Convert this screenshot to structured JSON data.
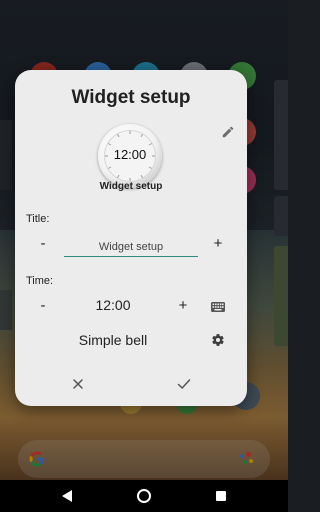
{
  "dialog": {
    "title": "Widget setup",
    "preview": {
      "clock_time": "12:00",
      "label": "Widget setup"
    },
    "title_section": {
      "label": "Title:",
      "decrement": "-",
      "increment": "+",
      "value": "Widget setup"
    },
    "time_section": {
      "label": "Time:",
      "decrement": "-",
      "value": "12:00",
      "increment": "+"
    },
    "sound": "Simple bell",
    "icons": {
      "edit": "pencil-icon",
      "keyboard": "keyboard-icon",
      "settings": "gear-icon",
      "cancel": "close-icon",
      "confirm": "check-icon"
    }
  },
  "colors": {
    "dialog_bg": "#ececec",
    "accent": "#2e8b80",
    "text": "#212121"
  }
}
